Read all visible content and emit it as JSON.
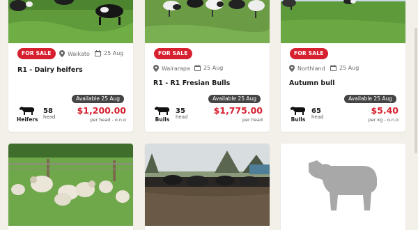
{
  "theme": {
    "accent_red": "#d6202f",
    "badge_grey": "#444444",
    "background": "#f3efe9"
  },
  "listings": [
    {
      "badge": "FOR SALE",
      "location": "Waikato",
      "date": "25 Aug",
      "title": "R1 - Dairy heifers",
      "availability": "Available 25 Aug",
      "animal_icon": "cow-icon",
      "animal_label": "Heifers",
      "count": "58",
      "count_unit": "head",
      "price": "$1,200.00",
      "price_unit": "per head - o.n.o"
    },
    {
      "badge": "FOR SALE",
      "location": "Wairarapa",
      "date": "25 Aug",
      "title": "R1 - R1 Fresian Bulls",
      "availability": "Available 25 Aug",
      "animal_icon": "cow-icon",
      "animal_label": "Bulls",
      "count": "35",
      "count_unit": "head",
      "price": "$1,775.00",
      "price_unit": "per head"
    },
    {
      "badge": "FOR SALE",
      "location": "Northland",
      "date": "25 Aug",
      "title": "Autumn bull",
      "availability": "Available 25 Aug",
      "animal_icon": "cow-icon",
      "animal_label": "Bulls",
      "count": "65",
      "count_unit": "head",
      "price": "$5.40",
      "price_unit": "per kg - o.n.o"
    },
    {
      "image": "sheep-photo"
    },
    {
      "image": "cattle-yard-photo"
    },
    {
      "image": "sheep-placeholder-icon"
    }
  ]
}
